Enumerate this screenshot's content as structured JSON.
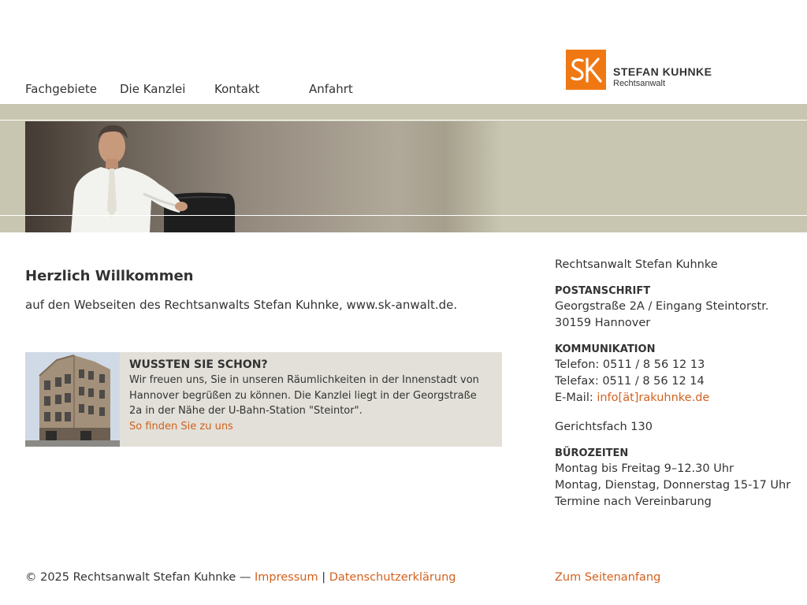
{
  "nav": {
    "items": [
      {
        "label": "Fachgebiete"
      },
      {
        "label": "Die Kanzlei"
      },
      {
        "label": "Kontakt"
      },
      {
        "label": "Anfahrt"
      }
    ]
  },
  "logo": {
    "mark": "SK",
    "name": "STEFAN KUHNKE",
    "subtitle": "Rechtsanwalt",
    "color": "#f07812"
  },
  "banner": {
    "background": "#c8c6b0",
    "photo_icon": "portrait-photo"
  },
  "main": {
    "title": "Herzlich Willkommen",
    "intro": "auf den Webseiten des Rechtsanwalts Stefan Kuhnke, www.sk-anwalt.de.",
    "infobox": {
      "title": "WUSSTEN SIE SCHON?",
      "body": "Wir freuen uns, Sie in unseren Räumlichkeiten in der Innenstadt von Hannover begrüßen zu können. Die Kanzlei liegt in der Georgstraße 2a in der Nähe der U-Bahn-Station \"Steintor\".",
      "link": "So finden Sie zu uns",
      "image_icon": "building-photo"
    }
  },
  "sidebar": {
    "name": "Rechtsanwalt Stefan Kuhnke",
    "address_heading": "POSTANSCHRIFT",
    "address_line1": "Georgstraße 2A / Eingang Steintorstr.",
    "address_line2": "30159 Hannover",
    "comm_heading": "KOMMUNIKATION",
    "phone": "Telefon: 0511 / 8 56 12 13",
    "fax": "Telefax: 0511 / 8 56 12 14",
    "email_label": "E-Mail:",
    "email": "info[ät]rakuhnke.de",
    "court_box": "Gerichtsfach 130",
    "hours_heading": "BÜROZEITEN",
    "hours_line1": "Montag bis Freitag 9–12.30 Uhr",
    "hours_line2": "Montag, Dienstag, Donnerstag 15-17 Uhr",
    "hours_line3": "Termine nach Vereinbarung"
  },
  "footer": {
    "copyright": "© 2025 Rechtsanwalt Stefan Kuhnke —",
    "impressum": "Impressum",
    "separator": "|",
    "privacy": "Datenschutzerklärung",
    "to_top": "Zum Seitenanfang"
  },
  "colors": {
    "accent": "#d2611e",
    "text": "#333333",
    "infobox_bg": "#e2e0d8"
  }
}
